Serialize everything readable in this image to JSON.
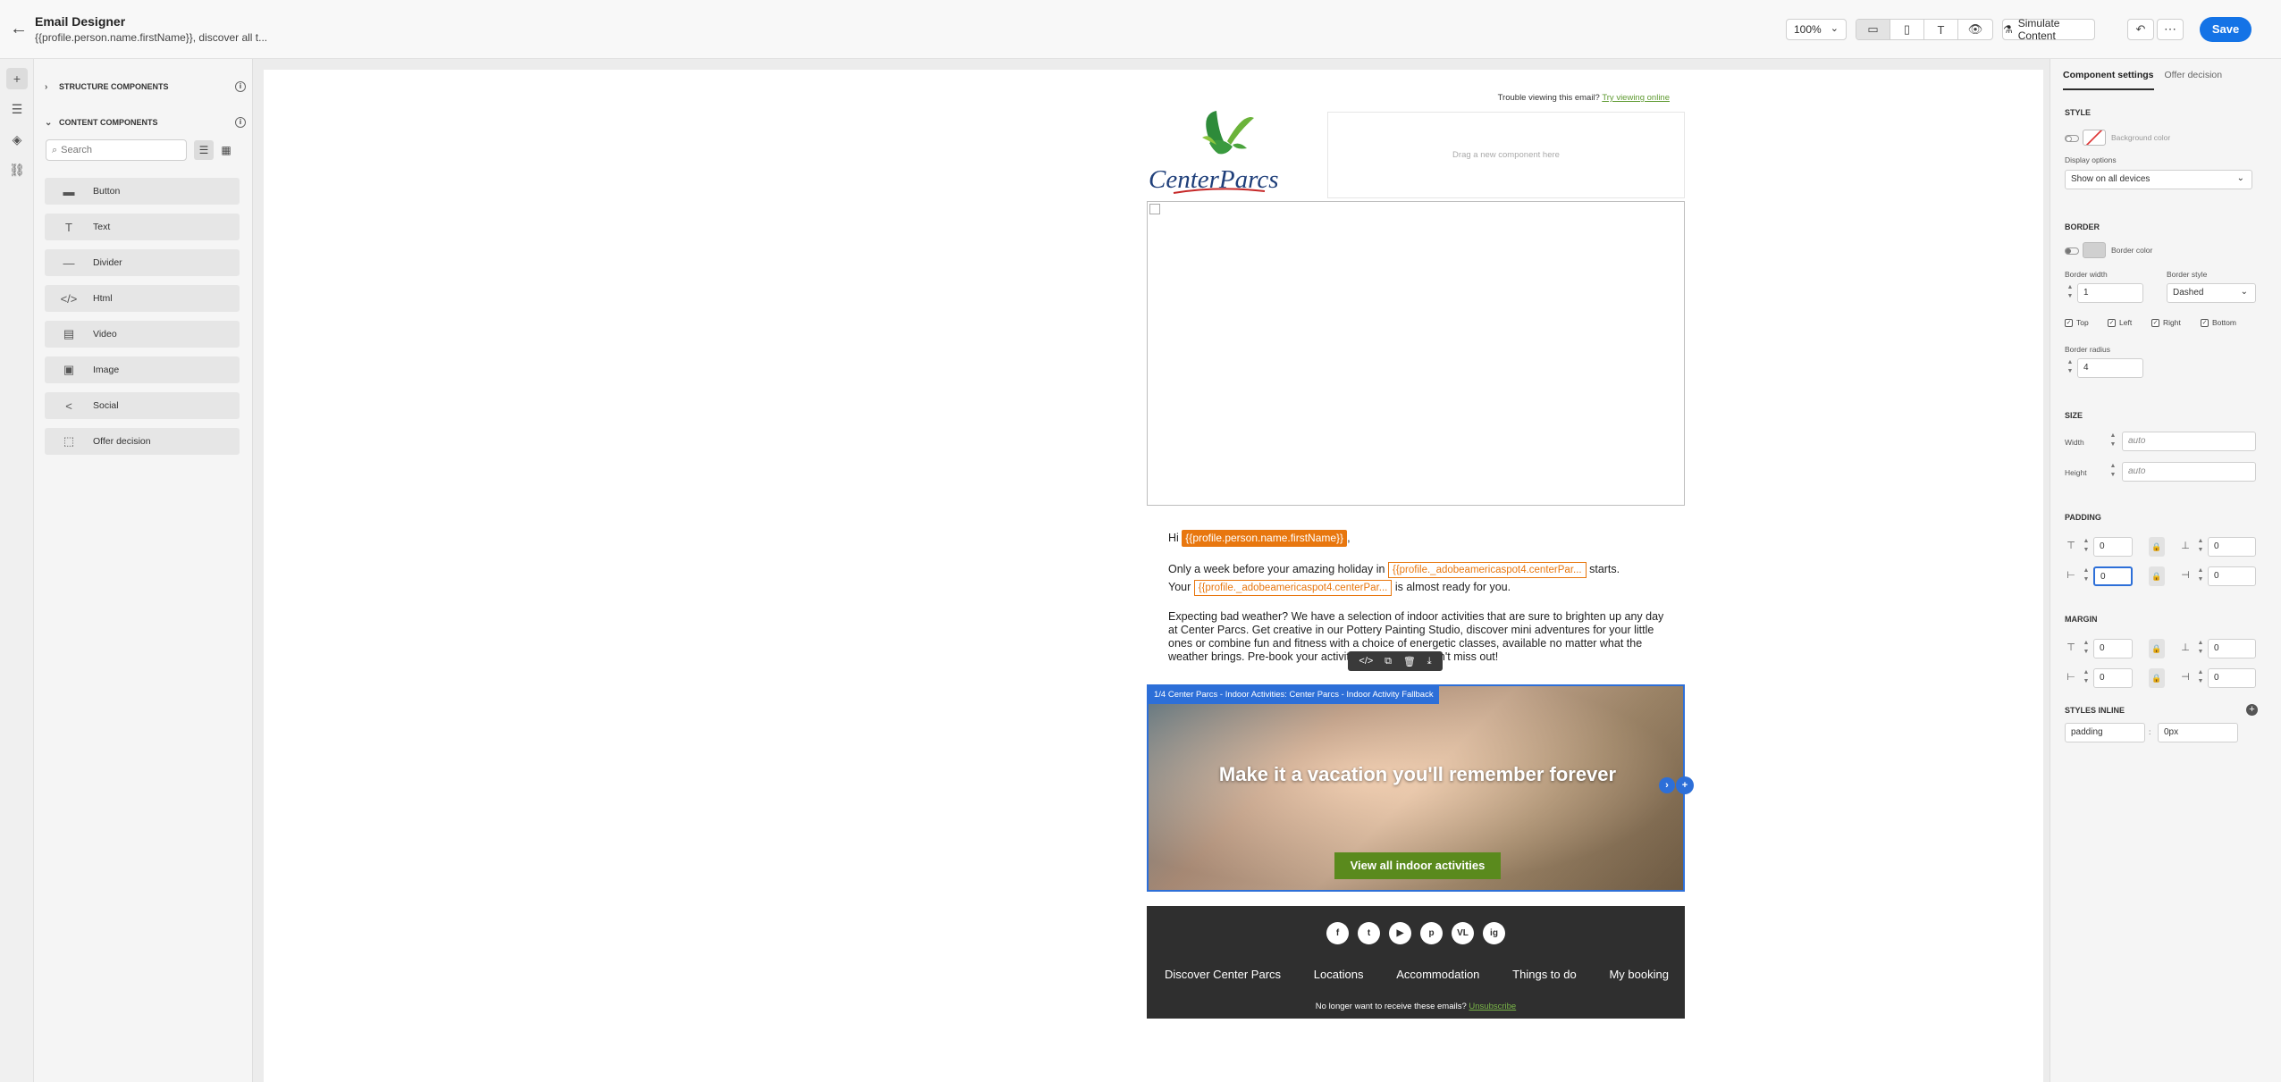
{
  "header": {
    "title": "Email Designer",
    "subtitle": "{{profile.person.name.firstName}}, discover all t...",
    "zoom": "100%",
    "simulate_label": "Simulate Content",
    "save_label": "Save"
  },
  "left_panel": {
    "structure_label": "STRUCTURE COMPONENTS",
    "content_label": "CONTENT COMPONENTS",
    "search_placeholder": "Search",
    "components": [
      {
        "label": "Button",
        "icon": "button-icon"
      },
      {
        "label": "Text",
        "icon": "text-icon"
      },
      {
        "label": "Divider",
        "icon": "divider-icon"
      },
      {
        "label": "Html",
        "icon": "html-icon"
      },
      {
        "label": "Video",
        "icon": "video-icon"
      },
      {
        "label": "Image",
        "icon": "image-icon"
      },
      {
        "label": "Social",
        "icon": "social-icon"
      },
      {
        "label": "Offer decision",
        "icon": "offer-decision-icon"
      }
    ]
  },
  "email": {
    "trouble_text": "Trouble viewing this email?",
    "trouble_link": "Try viewing online",
    "logo_text": "CenterParcs",
    "drag_text": "Drag a new component here",
    "greeting_prefix": "Hi",
    "greeting_token": "{{profile.person.name.firstName}}",
    "greeting_suffix": ",",
    "p1_a": "Only a week before your amazing holiday in",
    "p1_token1": "{{profile._adobeamericaspot4.centerPar...",
    "p1_b": "starts.",
    "p1_c": "Your",
    "p1_token2": "{{profile._adobeamericaspot4.centerPar...",
    "p1_d": "is almost ready for you.",
    "p2": "Expecting bad weather? We have a selection of indoor activities that are sure to brighten up any day at Center Parcs. Get creative in our Pottery Painting Studio, discover mini adventures for your little ones or combine fun and fitness with a choice of energetic classes, available no matter what the weather brings. Pre-book your activities now so you don't miss out!",
    "photo_label": "1/4 Center Parcs - Indoor Activities: Center Parcs - Indoor Activity Fallback",
    "photo_headline": "Make it a vacation you'll remember forever",
    "photo_cta": "View all indoor activities",
    "social": [
      "f",
      "t",
      "▶",
      "p",
      "VL",
      "ig"
    ],
    "footer_links": [
      "Discover Center Parcs",
      "Locations",
      "Accommodation",
      "Things to do",
      "My booking"
    ],
    "unsub_text": "No longer want to receive these emails?",
    "unsub_link": "Unsubscribe"
  },
  "right_panel": {
    "tab_settings": "Component settings",
    "tab_offer": "Offer decision",
    "style_label": "STYLE",
    "bg_color_label": "Background color",
    "display_options_label": "Display options",
    "display_options_value": "Show on all devices",
    "border_label": "BORDER",
    "border_color_label": "Border color",
    "border_width_label": "Border width",
    "border_width_value": "1",
    "border_style_label": "Border style",
    "border_style_value": "Dashed",
    "sides": [
      "Top",
      "Left",
      "Right",
      "Bottom"
    ],
    "border_radius_label": "Border radius",
    "border_radius_value": "4",
    "size_label": "SIZE",
    "width_label": "Width",
    "width_value": "auto",
    "height_label": "Height",
    "height_value": "auto",
    "padding_label": "PADDING",
    "padding_values": [
      "0",
      "0",
      "0",
      "0"
    ],
    "margin_label": "MARGIN",
    "margin_values": [
      "0",
      "0",
      "0",
      "0"
    ],
    "styles_inline_label": "STYLES INLINE",
    "inline_property": "padding",
    "inline_value": "0px"
  },
  "colors": {
    "accent": "#1473e6",
    "token": "#e8770f",
    "selection": "#2d6fd8",
    "cta": "#5a8a1d",
    "footer": "#2f2f2f"
  }
}
